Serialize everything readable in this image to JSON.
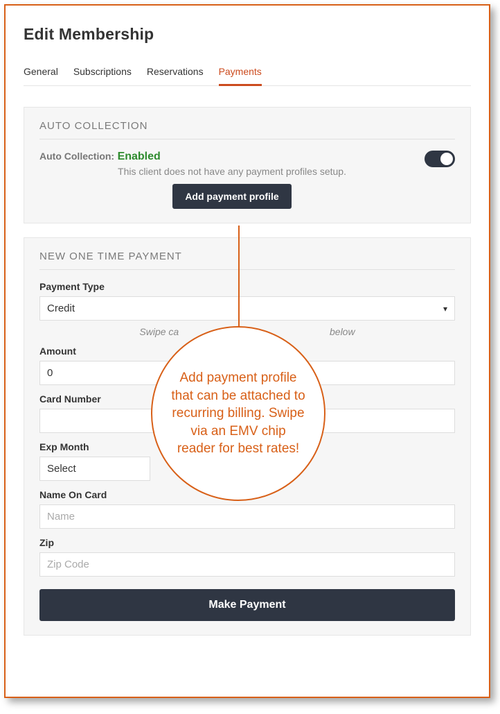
{
  "page_title": "Edit Membership",
  "tabs": {
    "general": "General",
    "subscriptions": "Subscriptions",
    "reservations": "Reservations",
    "payments": "Payments",
    "active": "payments"
  },
  "auto_collection": {
    "title": "AUTO COLLECTION",
    "label": "Auto Collection:",
    "status": "Enabled",
    "message": "This client does not have any payment profiles setup.",
    "add_button": "Add payment profile",
    "toggle_on": true
  },
  "one_time": {
    "title": "NEW ONE TIME PAYMENT",
    "payment_type_label": "Payment Type",
    "payment_type_value": "Credit",
    "swipe_hint_left": "Swipe ca",
    "swipe_hint_right": " below",
    "amount_label": "Amount",
    "amount_value": "0",
    "card_number_label": "Card Number",
    "card_number_value": "",
    "exp_month_label": "Exp Month",
    "exp_month_value": "Select",
    "exp_year_label": "",
    "name_label": "Name On Card",
    "name_placeholder": "Name",
    "zip_label": "Zip",
    "zip_placeholder": "Zip Code",
    "make_payment": "Make Payment"
  },
  "callout": "Add payment profile that can be attached to recurring billing. Swipe via an EMV chip reader for best rates!"
}
